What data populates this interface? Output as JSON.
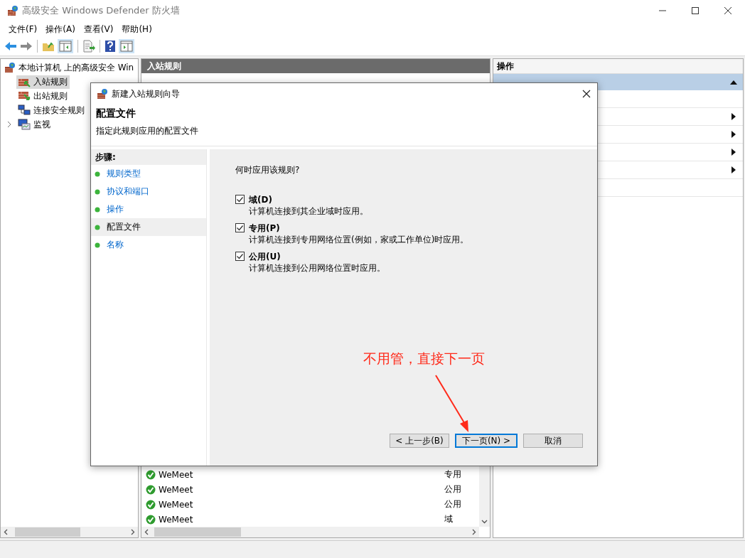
{
  "window": {
    "title": "高级安全 Windows Defender 防火墙"
  },
  "menu": [
    "文件(F)",
    "操作(A)",
    "查看(V)",
    "帮助(H)"
  ],
  "tree": {
    "label": "本地计算机 上的高级安全 Win",
    "children": [
      {
        "label": "入站规则",
        "kind": "inbound",
        "selected": true
      },
      {
        "label": "出站规则",
        "kind": "outbound",
        "selected": false
      },
      {
        "label": "连接安全规则",
        "kind": "connection",
        "selected": false
      },
      {
        "label": "监视",
        "kind": "monitor",
        "selected": false,
        "expanded": false
      }
    ]
  },
  "rules_panel": {
    "title": "入站规则",
    "rows": [
      {
        "name": "WeMeet",
        "profile": "专用"
      },
      {
        "name": "WeMeet",
        "profile": "公用"
      },
      {
        "name": "WeMeet",
        "profile": "公用"
      },
      {
        "name": "WeMeet",
        "profile": "域"
      }
    ]
  },
  "actions_panel": {
    "title": "操作"
  },
  "dialog": {
    "title": "新建入站规则向导",
    "heading": "配置文件",
    "subheading": "指定此规则应用的配置文件",
    "steps_title": "步骤:",
    "steps": [
      {
        "label": "规则类型",
        "selected": false
      },
      {
        "label": "协议和端口",
        "selected": false
      },
      {
        "label": "操作",
        "selected": false
      },
      {
        "label": "配置文件",
        "selected": true
      },
      {
        "label": "名称",
        "selected": false
      }
    ],
    "question": "何时应用该规则?",
    "options": [
      {
        "label": "域(D)",
        "description": "计算机连接到其企业域时应用。",
        "checked": true
      },
      {
        "label": "专用(P)",
        "description": "计算机连接到专用网络位置(例如，家或工作单位)时应用。",
        "checked": true
      },
      {
        "label": "公用(U)",
        "description": "计算机连接到公用网络位置时应用。",
        "checked": true
      }
    ],
    "buttons": [
      {
        "label": "< 上一步(B)",
        "default": false
      },
      {
        "label": "下一页(N) >",
        "default": true
      },
      {
        "label": "取消",
        "default": false
      }
    ]
  },
  "annotation": {
    "text": "不用管，直接下一页"
  }
}
